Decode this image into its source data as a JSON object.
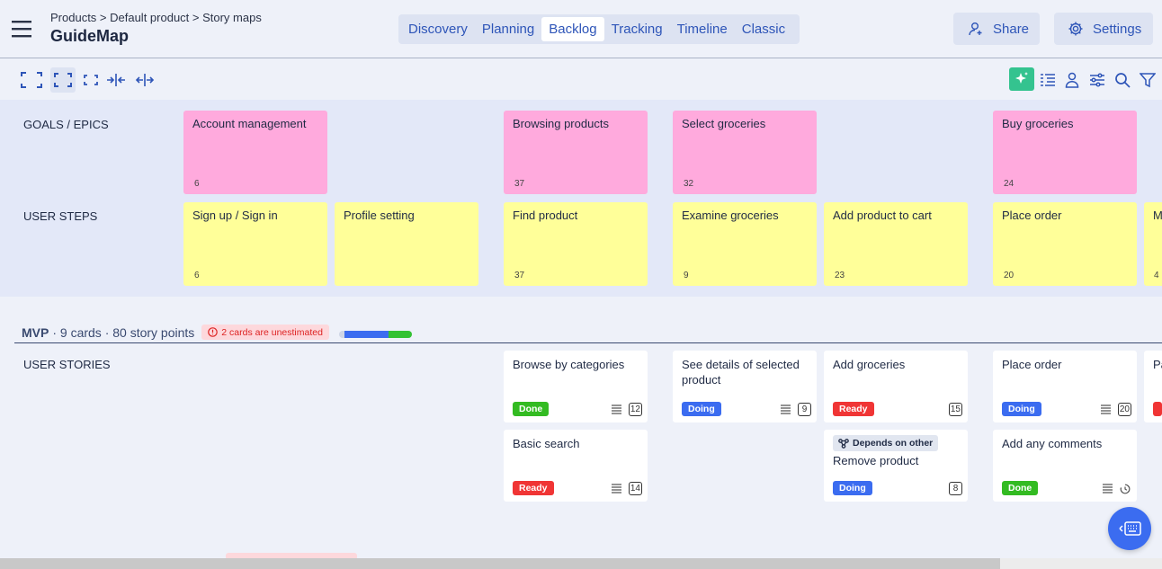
{
  "header": {
    "breadcrumb": "Products > Default product > Story maps",
    "title": "GuideMap",
    "tabs": [
      {
        "label": "Discovery",
        "active": false
      },
      {
        "label": "Planning",
        "active": false
      },
      {
        "label": "Backlog",
        "active": true
      },
      {
        "label": "Tracking",
        "active": false
      },
      {
        "label": "Timeline",
        "active": false
      },
      {
        "label": "Classic",
        "active": false
      }
    ],
    "share_label": "Share",
    "settings_label": "Settings"
  },
  "toolbar": {
    "left_tools": [
      "expand-all-icon",
      "compact-view-icon",
      "small-view-icon",
      "collapse-columns-icon",
      "expand-columns-icon"
    ],
    "right_tools": [
      "ai-assistant-icon",
      "list-view-icon",
      "user-filter-icon",
      "display-settings-icon",
      "search-icon",
      "filter-icon"
    ]
  },
  "map": {
    "goals_label": "GOALS / EPICS",
    "steps_label": "USER STEPS",
    "stories_label": "USER STORIES",
    "goals": [
      {
        "title": "Account management",
        "count": "6"
      },
      {
        "title": "Browsing products",
        "count": "37"
      },
      {
        "title": "Select groceries",
        "count": "32"
      },
      {
        "title": "Buy groceries",
        "count": "24"
      }
    ],
    "steps": [
      {
        "title": "Sign up / Sign in",
        "count": "6"
      },
      {
        "title": "Profile setting",
        "count": ""
      },
      {
        "title": "Find product",
        "count": "37"
      },
      {
        "title": "Examine groceries",
        "count": "9"
      },
      {
        "title": "Add product to cart",
        "count": "23"
      },
      {
        "title": "Place order",
        "count": "20"
      },
      {
        "title": "M",
        "count": "4"
      }
    ]
  },
  "release": {
    "name": "MVP",
    "info": " · 9 cards · 80 story points",
    "warning": "2 cards are unestimated",
    "progress": {
      "unestimated": 0.08,
      "doing": 0.6,
      "done": 0.32
    }
  },
  "stories": [
    {
      "title": "Browse by categories",
      "status": "Done",
      "points": "12",
      "dependency": ""
    },
    {
      "title": "Basic search",
      "status": "Ready",
      "points": "14",
      "dependency": ""
    },
    {
      "title": "See details of selected product",
      "status": "Doing",
      "points": "9",
      "dependency": ""
    },
    {
      "title": "Add groceries",
      "status": "Ready",
      "points": "15",
      "dependency": ""
    },
    {
      "title": "Remove product",
      "status": "Doing",
      "points": "8",
      "dependency": "Depends on other"
    },
    {
      "title": "Place order",
      "status": "Doing",
      "points": "20",
      "dependency": ""
    },
    {
      "title": "Add any comments",
      "status": "Done",
      "points": "",
      "dependency": ""
    },
    {
      "title": "Pa",
      "status": "",
      "points": "",
      "dependency": ""
    }
  ],
  "colors": {
    "goal": "#ffaadd",
    "step": "#ffff99",
    "accent": "#2e55b8",
    "done": "#33bb22",
    "doing": "#3b6cf0",
    "ready": "#f03535",
    "ai": "#34c38f"
  }
}
